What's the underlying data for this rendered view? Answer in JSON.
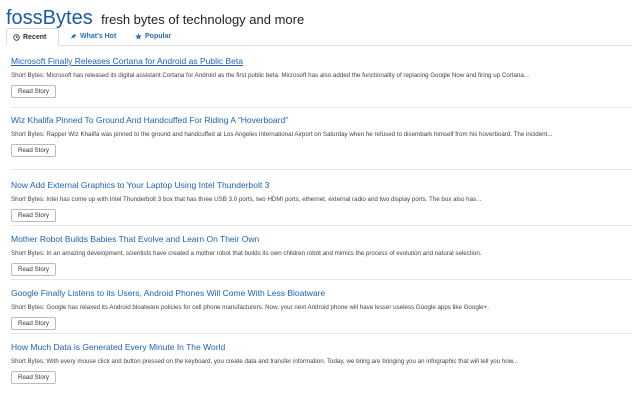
{
  "header": {
    "brand": "fossBytes",
    "tagline": "fresh bytes of technology and more"
  },
  "tabs": [
    {
      "label": "Recent",
      "icon": "clock-icon",
      "active": true
    },
    {
      "label": "What's Hot",
      "icon": "pin-icon",
      "active": false
    },
    {
      "label": "Popular",
      "icon": "star-icon",
      "active": false
    }
  ],
  "stories": [
    {
      "title": "Microsoft Finally Releases Cortana for Android as Public Beta",
      "summary": "Short Bytes: Microsoft has released its digital assistant Cortana for Android as the first public beta. Microsoft has also added the functionality of replacing Google Now and firing up Cortana...",
      "button": "Read Story"
    },
    {
      "title": "Wiz Khalifa Pinned To Ground And Handcuffed For Riding A “Hoverboard”",
      "summary": "Short Bytes: Rapper Wiz Khalifa was pinned to the ground and handcuffed at Los Angeles International Airport on Saturday when he refused to disembark himself from his hoverboard. The incident...",
      "button": "Read Story"
    },
    {
      "title": "Now Add External Graphics to Your Laptop Using Intel Thunderbolt 3",
      "summary": "Short Bytes: Intel has come up with Intel Thunderbolt 3 box that has three USB 3.0 ports, two HDMI ports, ethernet, external radio and two display ports. The box also has...",
      "button": "Read Story"
    },
    {
      "title": "Mother Robot Builds Babies That Evolve and Learn On Their Own",
      "summary": "Short Bytes: In an amazing development, scientists have created a mother robot that builds its own children robot and mimics the process of evolution and natural selection.",
      "button": "Read Story"
    },
    {
      "title": "Google Finally Listens to its Users, Android Phones Will Come With Less Bloatware",
      "summary": "Short Bytes: Google has relaxed its Android bloatware policies for cell phone manufacturers. Now, your next Android phone will have lesser useless Google apps like Google+.",
      "button": "Read Story"
    },
    {
      "title": "How Much Data is Generated Every Minute In The World",
      "summary": "Short Bytes: With every mouse click and button pressed on the keyboard, you create data and transfer information. Today, we bring are bringing you an infographic that will tell you how...",
      "button": "Read Story"
    }
  ]
}
